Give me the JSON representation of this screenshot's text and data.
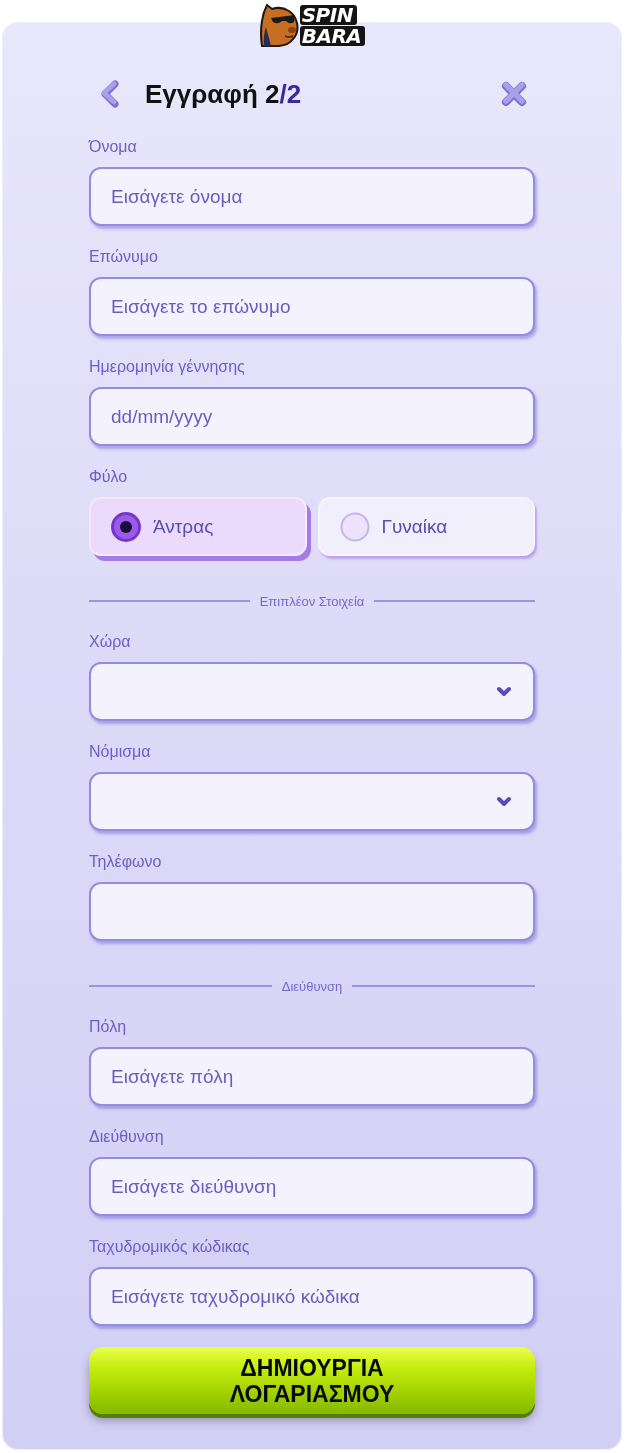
{
  "logo": {
    "lines": [
      "SPIN",
      "BARA"
    ]
  },
  "header": {
    "title": "Εγγραφή 2",
    "title_accent": "/2"
  },
  "form": [
    {
      "kind": "input",
      "label": "Όνομα",
      "placeholder": "Εισάγετε όνομα"
    },
    {
      "kind": "input",
      "label": "Επώνυμο",
      "placeholder": "Εισάγετε το επώνυμο"
    },
    {
      "kind": "input",
      "label": "Ημερομηνία γέννησης",
      "placeholder": "dd/mm/yyyy"
    },
    {
      "kind": "radio",
      "label": "Φύλο",
      "options": [
        {
          "label": "Άντρας",
          "selected": true
        },
        {
          "label": "Γυναίκα",
          "selected": false
        }
      ]
    },
    {
      "kind": "divider",
      "text": "Επιπλέον Στοιχεία"
    },
    {
      "kind": "select",
      "label": "Χώρα"
    },
    {
      "kind": "select",
      "label": "Νόμισμα"
    },
    {
      "kind": "input",
      "label": "Τηλέφωνο"
    },
    {
      "kind": "divider",
      "text": "Διεύθυνση"
    },
    {
      "kind": "input",
      "label": "Πόλη",
      "placeholder": "Εισάγετε πόλη"
    },
    {
      "kind": "input",
      "label": "Διεύθυνση",
      "placeholder": "Εισάγετε διεύθυνση"
    },
    {
      "kind": "input",
      "label": "Ταχυδρομικός κώδικας",
      "placeholder": "Εισάγετε ταχυδρομικό κώδικα"
    }
  ],
  "submit_button": {
    "label": "ΔΗΜΙΟΥΡΓΙΑ ΛΟΓΑΡΙΑΣΜΟΥ"
  }
}
